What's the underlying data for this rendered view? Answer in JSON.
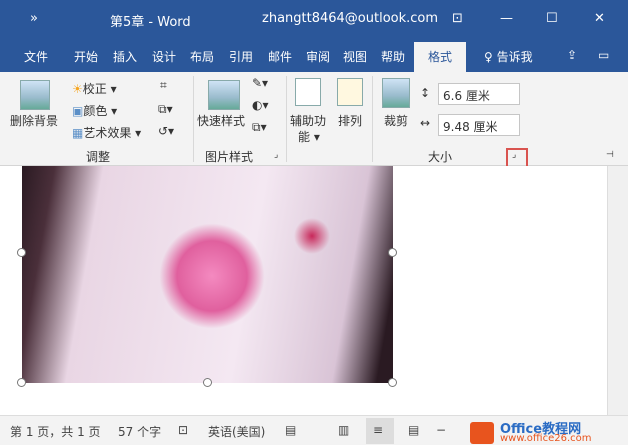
{
  "title": {
    "quick_access": "»",
    "doc": "第5章  -  Word",
    "account": "zhangtt8464@outlook.com"
  },
  "tabs": [
    "文件",
    "开始",
    "插入",
    "设计",
    "布局",
    "引用",
    "邮件",
    "审阅",
    "视图",
    "帮助",
    "格式"
  ],
  "tell_me": "告诉我",
  "ribbon": {
    "remove_bg": "删除背景",
    "correct": "校正 ▾",
    "color": "颜色 ▾",
    "art": "艺术效果 ▾",
    "adjust": "调整",
    "quick_style": "快速样式",
    "pic_style": "图片样式",
    "assist": "辅助功",
    "assist2": "能 ▾",
    "arrange": "排列",
    "crop": "裁剪",
    "size": "大小",
    "height": "6.6 厘米",
    "width": "9.48 厘米"
  },
  "status": {
    "page": "第 1 页，共 1 页",
    "words": "57 个字",
    "lang": "英语(美国)",
    "watermark": "Office教程网",
    "watermark2": "www.office26.com"
  }
}
